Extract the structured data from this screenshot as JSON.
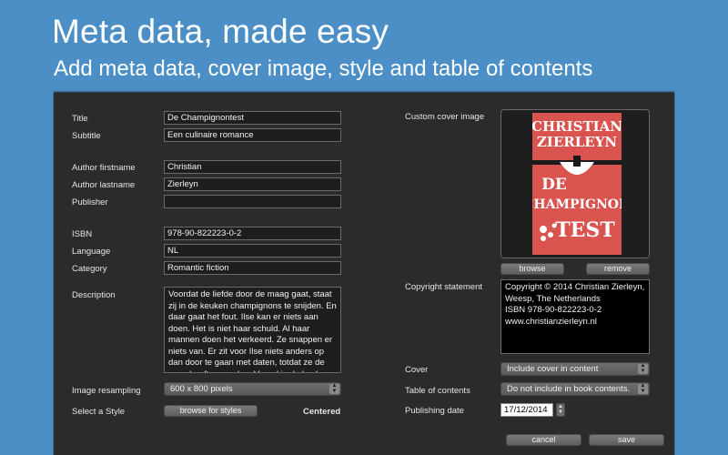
{
  "hero": {
    "title": "Meta data, made easy",
    "subtitle": "Add meta data, cover image, style and table of contents"
  },
  "form": {
    "title_label": "Title",
    "title_value": "De Champignontest",
    "subtitle_label": "Subtitle",
    "subtitle_value": "Een culinaire romance",
    "author_first_label": "Author firstname",
    "author_first_value": "Christian",
    "author_last_label": "Author lastname",
    "author_last_value": "Zierleyn",
    "publisher_label": "Publisher",
    "publisher_value": "",
    "isbn_label": "ISBN",
    "isbn_value": "978-90-822223-0-2",
    "language_label": "Language",
    "language_value": "NL",
    "category_label": "Category",
    "category_value": "Romantic fiction",
    "description_label": "Description",
    "description_value": "Voordat de liefde door de maag gaat, staat zij in de keuken champignons te snijden. En daar gaat het fout. Ilse kan er niets aan doen. Het is niet haar schuld. Al haar mannen doen het verkeerd. Ze snappen er niets van. Er zit voor Ilse niets anders op dan door te gaan met daten, totdat ze de ware heeft gevonden. Vooral in de keuken",
    "resampling_label": "Image resampling",
    "resampling_value": "600 x 800 pixels",
    "style_label": "Select a Style",
    "browse_styles_label": "browse for styles",
    "style_value": "Centered"
  },
  "cover": {
    "label": "Custom cover image",
    "book_author_line1": "CHRISTIAN",
    "book_author_line2": "ZIERLEYN",
    "book_title_line1": "DE",
    "book_title_line2": "CHAMPIGNON",
    "book_title_line3": "TEST",
    "browse_label": "browse",
    "remove_label": "remove",
    "cover_red": "#d9534f"
  },
  "copyright": {
    "label": "Copyright statement",
    "line1": "Copyright © 2014 Christian Zierleyn,",
    "line2": "Weesp, The Netherlands",
    "line3": "ISBN 978-90-822223-0-2",
    "line4": "www.christianzierleyn.nl"
  },
  "options": {
    "cover_label": "Cover",
    "cover_value": "Include cover in content",
    "toc_label": "Table of contents",
    "toc_value": "Do not include in book contents.",
    "date_label": "Publishing date",
    "date_value": "17/12/2014"
  },
  "actions": {
    "cancel_label": "cancel",
    "save_label": "save"
  }
}
